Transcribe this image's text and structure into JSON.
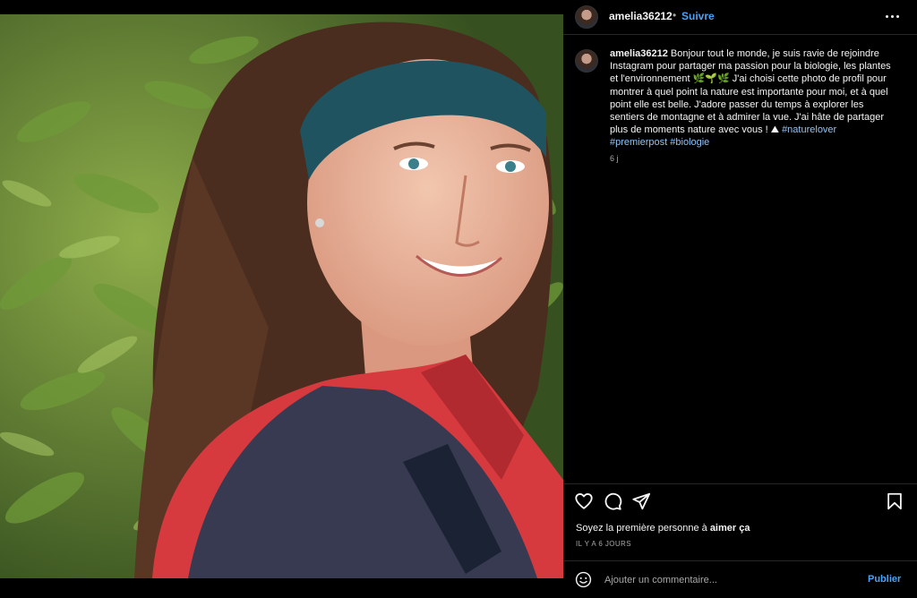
{
  "post": {
    "author": "amelia36212",
    "dot": "•",
    "follow_label": "Suivre",
    "caption": {
      "username": "amelia36212",
      "text": "Bonjour tout le monde, je suis ravie de rejoindre Instagram pour partager ma passion pour la biologie, les plantes et l'environnement 🌿🌱🌿 J'ai choisi cette photo de profil pour montrer à quel point la nature est importante pour moi, et à quel point elle est belle. J'adore passer du temps à explorer les sentiers de montagne et à admirer la vue. J'ai hâte de partager plus de moments nature avec vous ! ⛰",
      "hashtags": [
        "#naturelover",
        "#premierpost",
        "#biologie"
      ],
      "age_short": "6 j"
    },
    "likes": {
      "prefix": "Soyez la première personne à ",
      "emphasis": "aimer ça"
    },
    "timestamp": "IL Y A 6 JOURS",
    "comment": {
      "placeholder": "Ajouter un commentaire...",
      "publish_label": "Publier"
    }
  },
  "colors": {
    "background": "#000000",
    "link_blue": "#4aa3f5",
    "hashtag_blue": "#8fc3f7",
    "muted": "#a8a8a8",
    "divider": "#262626"
  },
  "icons": [
    "more-options-icon",
    "heart-icon",
    "comment-icon",
    "share-icon",
    "bookmark-icon",
    "emoji-icon"
  ]
}
